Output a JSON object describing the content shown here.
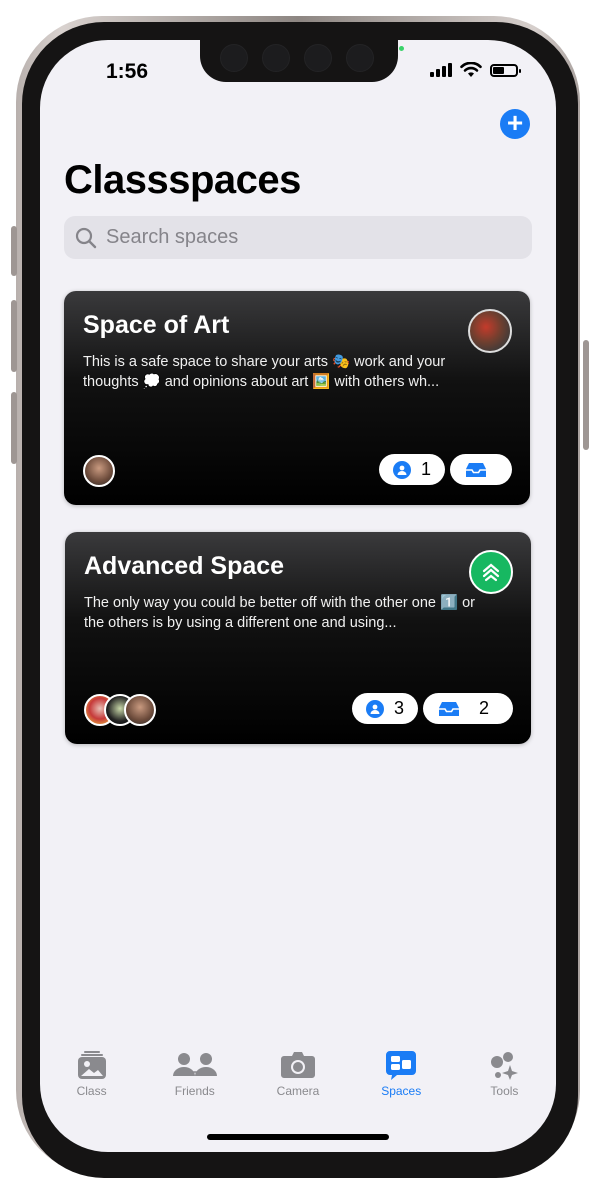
{
  "status_bar": {
    "time": "1:56"
  },
  "page": {
    "title": "Classspaces"
  },
  "search": {
    "placeholder": "Search spaces",
    "value": ""
  },
  "colors": {
    "accent": "#1a7cf5",
    "background": "#f2f1f6",
    "advanced_badge": "#17b861"
  },
  "spaces": [
    {
      "title": "Space of Art",
      "description": "This is a safe space to share your arts 🎭 work and your thoughts 💭 and opinions about art 🖼️ with others wh...",
      "icon": "art-image-icon",
      "members": "1",
      "inbox": ""
    },
    {
      "title": "Advanced Space",
      "description": "The only way you could be better off with the other one 1️⃣ or the others is by using a different one and using...",
      "icon": "chevrons-up-icon",
      "members": "3",
      "inbox": "2"
    }
  ],
  "tabs": [
    {
      "label": "Class",
      "icon": "photo-stack-icon",
      "active": false
    },
    {
      "label": "Friends",
      "icon": "people-icon",
      "active": false
    },
    {
      "label": "Camera",
      "icon": "camera-icon",
      "active": false
    },
    {
      "label": "Spaces",
      "icon": "chat-bubbles-icon",
      "active": true
    },
    {
      "label": "Tools",
      "icon": "sparkles-icon",
      "active": false
    }
  ]
}
